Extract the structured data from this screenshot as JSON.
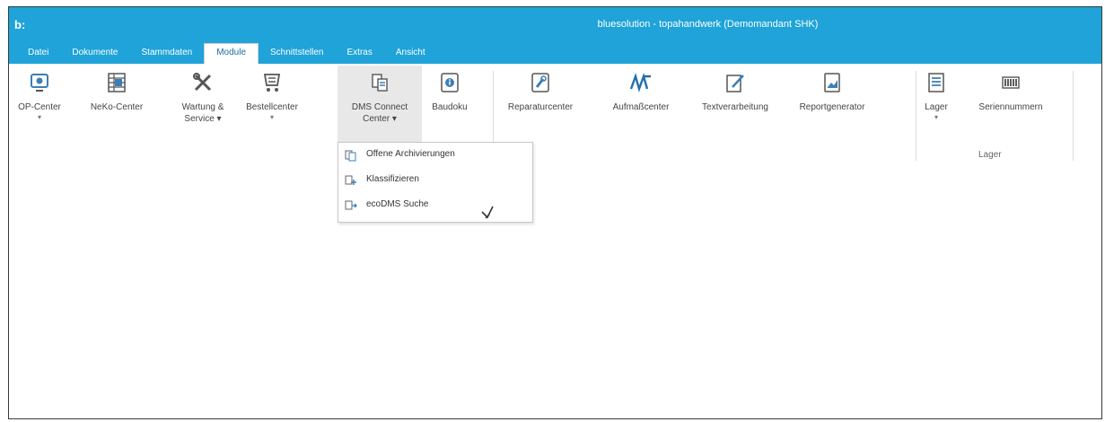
{
  "window": {
    "app_logo": "b:",
    "title": "bluesolution - topahandwerk (Demomandant SHK)"
  },
  "menu": {
    "tabs": [
      {
        "label": "Datei"
      },
      {
        "label": "Dokumente"
      },
      {
        "label": "Stammdaten"
      },
      {
        "label": "Module"
      },
      {
        "label": "Schnittstellen"
      },
      {
        "label": "Extras"
      },
      {
        "label": "Ansicht"
      }
    ],
    "active_tab": "Module"
  },
  "ribbon": {
    "buttons": [
      {
        "label": "OP-Center",
        "icon": "op-center-icon",
        "caret": "▾"
      },
      {
        "label": "NeKo-Center",
        "icon": "neko-center-icon",
        "caret": ""
      },
      {
        "label": "Wartung &",
        "label2": "Service ▾",
        "icon": "wrench-screwdriver-icon",
        "caret": ""
      },
      {
        "label": "Bestellcenter",
        "icon": "cart-icon",
        "caret": "▾"
      },
      {
        "label": "DMS Connect",
        "label2": "Center ▾",
        "icon": "dms-connect-icon",
        "caret": ""
      },
      {
        "label": "Baudoku",
        "icon": "info-doc-icon",
        "caret": ""
      },
      {
        "label": "Reparaturcenter",
        "icon": "repair-icon",
        "caret": ""
      },
      {
        "label": "Aufmaßcenter",
        "icon": "aufmass-icon",
        "caret": ""
      },
      {
        "label": "Textverarbeitung",
        "icon": "edit-note-icon",
        "caret": ""
      },
      {
        "label": "Reportgenerator",
        "icon": "report-icon",
        "caret": ""
      },
      {
        "label": "Lager",
        "icon": "list-icon",
        "caret": "▾"
      },
      {
        "label": "Seriennummern",
        "icon": "barcode-icon",
        "caret": ""
      }
    ],
    "group_label_lager": "Lager"
  },
  "dropdown": {
    "items": [
      {
        "label": "Offene Archivierungen",
        "icon": "archive-icon"
      },
      {
        "label": "Klassifizieren",
        "icon": "classify-icon"
      },
      {
        "label": "ecoDMS Suche",
        "icon": "ecodms-search-icon"
      }
    ]
  },
  "colors": {
    "titlebar": "#1fa3d8",
    "accent": "#1c6ea0"
  }
}
